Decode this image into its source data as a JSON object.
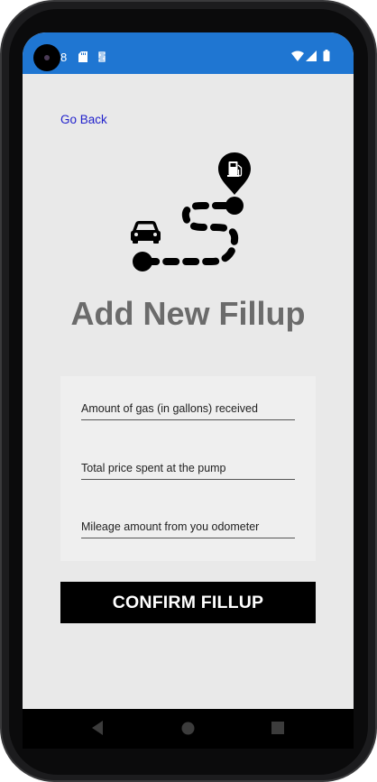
{
  "status_bar": {
    "time": "8",
    "background": "#1f76d2",
    "icons": [
      "sd-card-icon",
      "notification-icon",
      "wifi-icon",
      "signal-icon",
      "battery-icon"
    ]
  },
  "navigation": {
    "go_back_label": "Go Back",
    "link_color": "#2222cc"
  },
  "hero": {
    "icon": "route-car-to-gas-station-icon"
  },
  "page": {
    "title": "Add New Fillup",
    "title_color": "#6b6b6b",
    "background": "#e9e9e9"
  },
  "form": {
    "fields": [
      {
        "label": "Amount of gas (in gallons) received"
      },
      {
        "label": "Total price spent at the pump"
      },
      {
        "label": "Mileage amount from you odometer"
      }
    ]
  },
  "actions": {
    "confirm_label": "CONFIRM FILLUP"
  },
  "system_nav": {
    "buttons": [
      "back-icon",
      "home-icon",
      "recents-icon"
    ]
  }
}
